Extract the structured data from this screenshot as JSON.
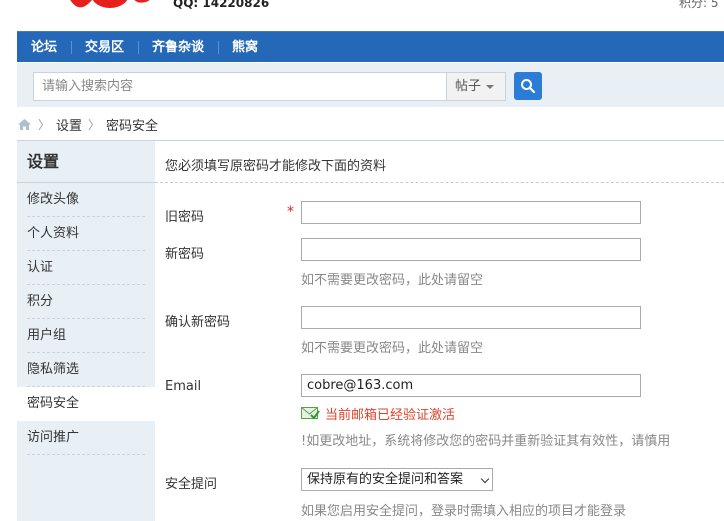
{
  "header": {
    "qq": "QQ:  14220826",
    "points": "积分: 5"
  },
  "nav": {
    "items": [
      "论坛",
      "交易区",
      "齐鲁杂谈",
      "熊窝"
    ]
  },
  "search": {
    "placeholder": "请输入搜索内容",
    "type": "帖子"
  },
  "breadcrumb": {
    "items": [
      "设置",
      "密码安全"
    ]
  },
  "sidebar": {
    "title": "设置",
    "items": [
      {
        "label": "修改头像"
      },
      {
        "label": "个人资料"
      },
      {
        "label": "认证"
      },
      {
        "label": "积分"
      },
      {
        "label": "用户组"
      },
      {
        "label": "隐私筛选"
      },
      {
        "label": "密码安全",
        "active": true
      },
      {
        "label": "访问推广"
      }
    ]
  },
  "form": {
    "notice": "您必须填写原密码才能修改下面的资料",
    "old_password": {
      "label": "旧密码",
      "required": "*",
      "value": ""
    },
    "new_password": {
      "label": "新密码",
      "value": "",
      "hint": "如不需要更改密码，此处请留空"
    },
    "confirm_password": {
      "label": "确认新密码",
      "value": "",
      "hint": "如不需要更改密码，此处请留空"
    },
    "email": {
      "label": "Email",
      "value": "cobre@163.com",
      "verified_text": "当前邮箱已经验证激活",
      "hint": "!如更改地址，系统将修改您的密码并重新验证其有效性，请慎用"
    },
    "security_question": {
      "label": "安全提问",
      "selected": "保持原有的安全提问和答案",
      "hint": "如果您启用安全提问，登录时需填入相应的项目才能登录"
    }
  },
  "colors": {
    "nav": "#2568b8",
    "accent": "#2c7bd6",
    "panel": "#e8eff5",
    "required": "#dd2222",
    "verified": "#d9452b"
  }
}
